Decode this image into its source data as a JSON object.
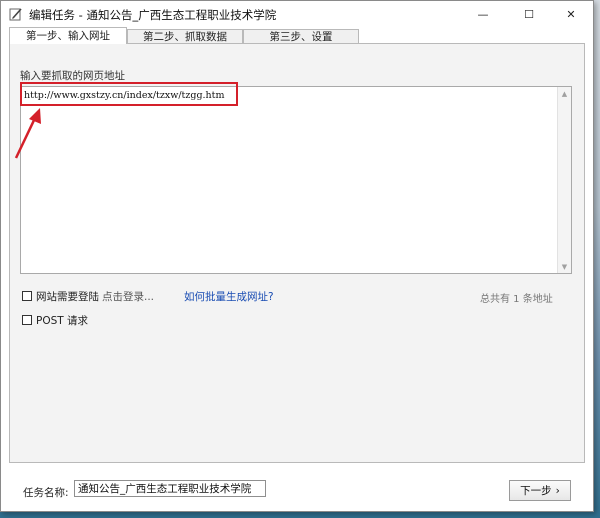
{
  "window": {
    "title": "编辑任务 - 通知公告_广西生态工程职业技术学院",
    "minimize_glyph": "—",
    "maximize_glyph": "☐",
    "close_glyph": "✕"
  },
  "tabs": [
    {
      "label": "第一步、输入网址"
    },
    {
      "label": "第二步、抓取数据"
    },
    {
      "label": "第三步、设置"
    }
  ],
  "url_section": {
    "label": "输入要抓取的网页地址",
    "value": "http://www.gxstzy.cn/index/tzxw/tzgg.htm"
  },
  "options": {
    "login_required": "网站需要登陆",
    "login_link": "点击登录...",
    "batch_link": "如何批量生成网址?",
    "count_text": "总共有 1 条地址",
    "post_request": "POST 请求"
  },
  "footer": {
    "task_name_label": "任务名称:",
    "task_name_value": "通知公告_广西生态工程职业技术学院",
    "next_button": "下一步",
    "next_glyph": "›"
  },
  "colors": {
    "annotation": "#d4202a",
    "link": "#1a4db3"
  }
}
